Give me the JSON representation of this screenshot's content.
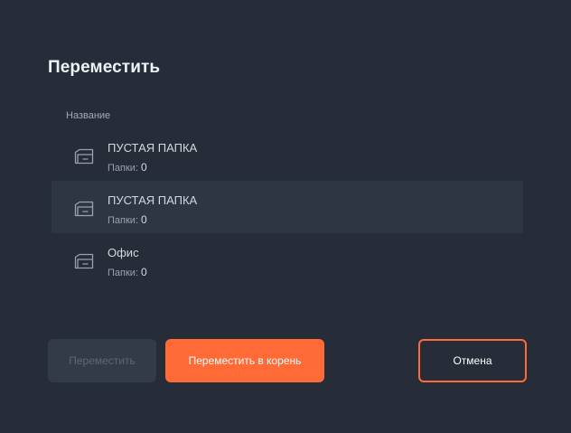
{
  "dialog": {
    "title": "Переместить",
    "column_header": "Название"
  },
  "folders": [
    {
      "name": "ПУСТАЯ ПАПКА",
      "meta_label": "Папки:",
      "count": "0",
      "selected": false
    },
    {
      "name": "ПУСТАЯ ПАПКА",
      "meta_label": "Папки:",
      "count": "0",
      "selected": true
    },
    {
      "name": "Офис",
      "meta_label": "Папки:",
      "count": "0",
      "selected": false
    }
  ],
  "buttons": {
    "move": "Переместить",
    "move_to_root": "Переместить в корень",
    "cancel": "Отмена"
  },
  "colors": {
    "background": "#262d39",
    "accent": "#ff6a36",
    "selected_row": "#2e3644",
    "disabled_button": "#343b48"
  },
  "icons": {
    "folder": "folder-icon"
  }
}
